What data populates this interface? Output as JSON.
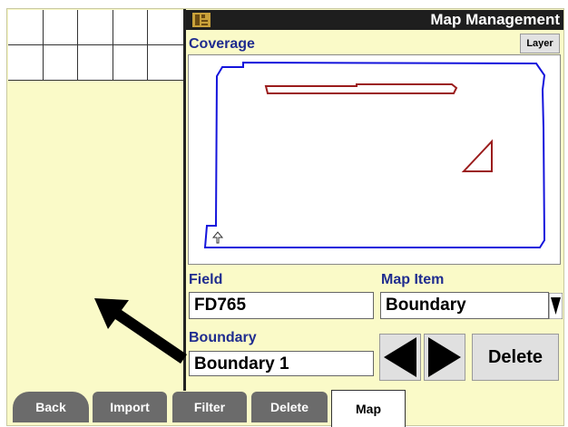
{
  "header": {
    "title": "Map Management",
    "icon": "app-icon"
  },
  "coverage": {
    "label": "Coverage",
    "layer_label": "Layer"
  },
  "field": {
    "label": "Field",
    "value": "FD765"
  },
  "map_item": {
    "label": "Map Item",
    "value": "Boundary"
  },
  "boundary": {
    "label": "Boundary",
    "value": "Boundary 1",
    "delete_label": "Delete"
  },
  "tabs": [
    {
      "label": "Back",
      "active": false
    },
    {
      "label": "Import",
      "active": false
    },
    {
      "label": "Filter",
      "active": false
    },
    {
      "label": "Delete",
      "active": false
    },
    {
      "label": "Map",
      "active": true
    }
  ],
  "colors": {
    "label_blue": "#1f2c8f",
    "boundary_blue": "#1414dc",
    "feature_red": "#9b1c1c",
    "panel_bg": "#fafac8"
  }
}
